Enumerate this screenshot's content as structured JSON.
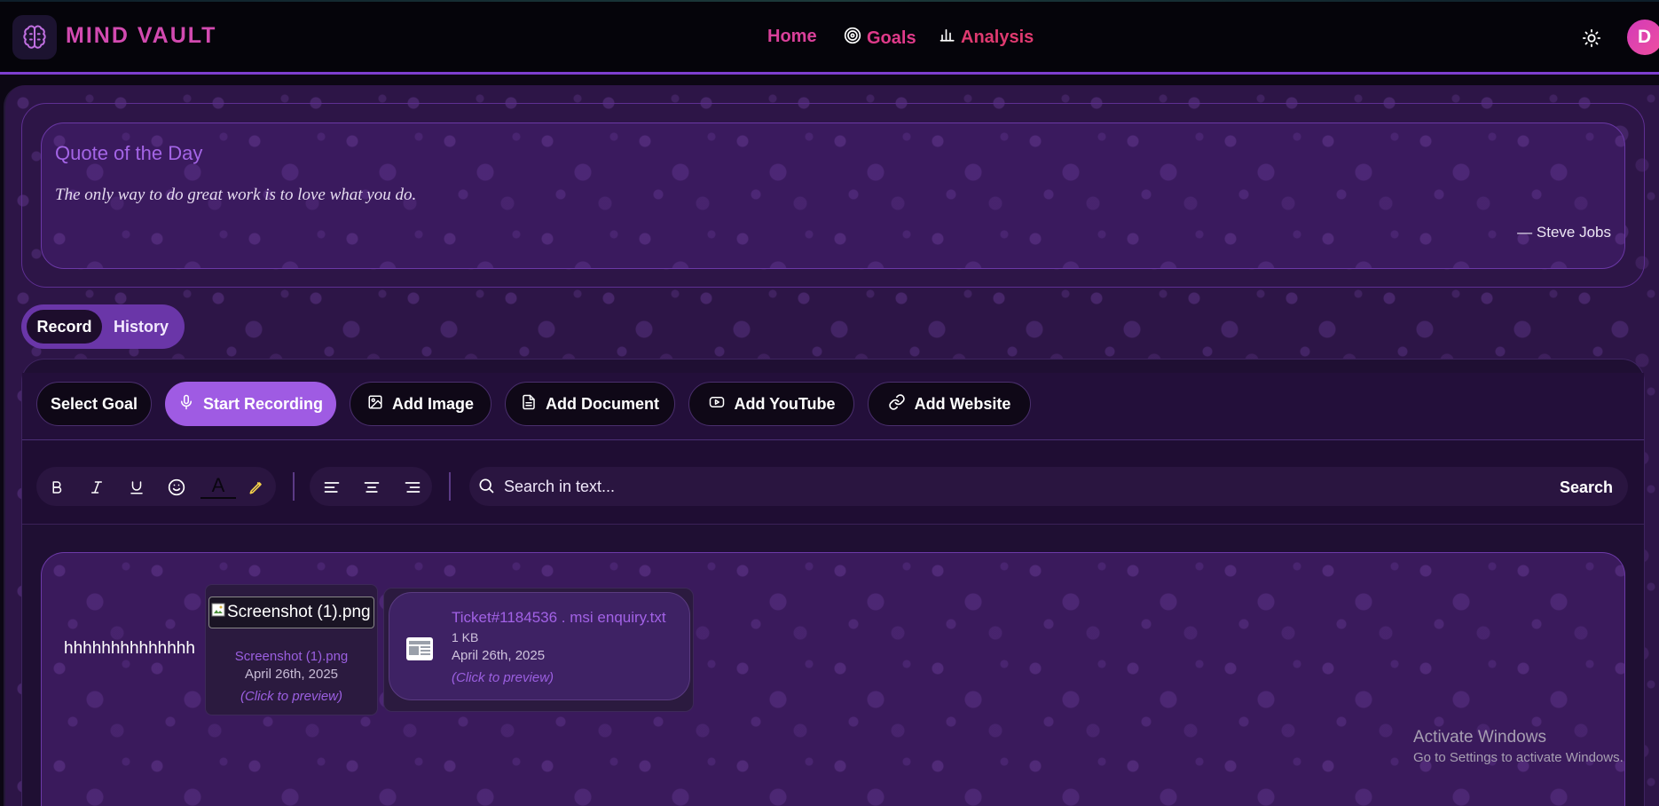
{
  "header": {
    "brand": "MIND VAULT",
    "logo_icon": "brain-icon",
    "nav": [
      {
        "label": "Home",
        "icon": ""
      },
      {
        "label": "Goals",
        "icon": "target-icon"
      },
      {
        "label": "Analysis",
        "icon": "bar-chart-icon"
      }
    ],
    "theme_icon": "sun-icon",
    "avatar_initial": "D"
  },
  "quote": {
    "title": "Quote of the Day",
    "text": "The only way to do great work is to love what you do.",
    "author": "— Steve Jobs"
  },
  "mode_toggle": {
    "record": "Record",
    "history": "History",
    "active": "Record"
  },
  "actions": {
    "select_goal": "Select Goal",
    "start_recording": "Start Recording",
    "add_image": "Add Image",
    "add_document": "Add Document",
    "add_youtube": "Add YouTube",
    "add_website": "Add Website"
  },
  "toolbar": {
    "format_icons": [
      "bold-icon",
      "italic-icon",
      "underline-icon",
      "emoji-icon",
      "text-color-icon",
      "highlight-icon"
    ],
    "align_icons": [
      "align-left-icon",
      "align-center-icon",
      "align-right-icon"
    ],
    "text_color_glyph": "A",
    "search_placeholder": "Search in text...",
    "search_button": "Search"
  },
  "colors": {
    "accent": "#9f5be3",
    "brand": "#d24ab0",
    "nav_link": "#e03a8a",
    "highlight": "#f2d04a"
  },
  "entry": {
    "text": "hhhhhhhhhhhhhh",
    "attachments": {
      "image": {
        "alt": "Screenshot (1).png",
        "name": "Screenshot (1).png",
        "date": "April 26th, 2025",
        "hint": "(Click to preview)"
      },
      "document": {
        "name": "Ticket#1184536 . msi enquiry.txt",
        "size": "1 KB",
        "date": "April 26th, 2025",
        "hint": "(Click to preview)"
      }
    }
  },
  "watermark": {
    "title": "Activate Windows",
    "subtitle": "Go to Settings to activate Windows."
  }
}
